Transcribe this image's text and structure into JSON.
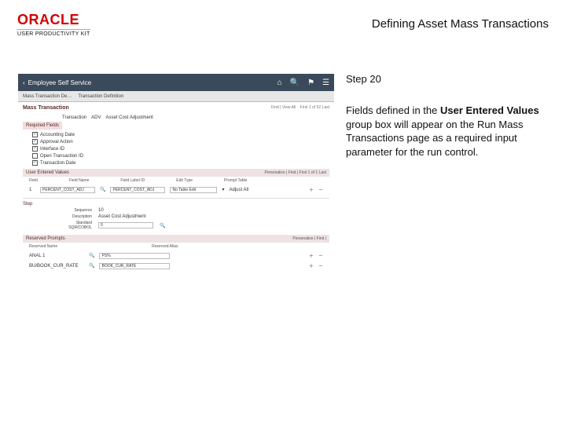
{
  "brand": {
    "oracle": "ORACLE",
    "upk": "USER PRODUCTIVITY KIT"
  },
  "page_title": "Defining Asset Mass Transactions",
  "step": {
    "label": "Step 20",
    "instruction_pre": "Fields defined in the ",
    "instruction_bold": "User Entered Values",
    "instruction_post": " group box will appear on the Run Mass Transactions page as a required input parameter for the run control."
  },
  "app": {
    "topbar_title": "Employee Self Service",
    "toolbar": {
      "item1": "Mass Transaction De…",
      "item2": "Transaction Definition"
    },
    "main_title": "Mass Transaction",
    "find_hint": "Find | View All",
    "first_meta": "First 1 of 52 Last",
    "transaction_row": {
      "label": "Transaction",
      "id": "ADV",
      "desc": "Asset Cost Adjustment"
    },
    "required_label": "Required Fields",
    "required_fields": [
      {
        "checked": true,
        "label": "Accounting Date"
      },
      {
        "checked": true,
        "label": "Approval Action"
      },
      {
        "checked": true,
        "label": "Interface ID"
      },
      {
        "checked": false,
        "label": "Open Transaction ID"
      },
      {
        "checked": true,
        "label": "Transaction Date"
      }
    ],
    "user_entered_values": {
      "title": "User Entered Values",
      "tools": "Personalize | Find | ",
      "row_count": "First 1 of 1 Last",
      "columns": [
        "Field",
        "Field Name",
        "Field Label ID",
        "Edit Type",
        "Prompt Table"
      ],
      "row": {
        "n": "1",
        "fieldName": "PERCENT_COST_ADJ",
        "labelId": "PERCENT_COST_ADJ",
        "editType": "No Table Edit",
        "prompt": "Adjust All"
      }
    },
    "step_section": "Step",
    "step_kv": [
      {
        "k": "Sequence",
        "v": "10"
      },
      {
        "k": "Description",
        "v": "Asset Cost Adjustment"
      },
      {
        "k": "Standard SQR/COBOL",
        "v": "0"
      }
    ],
    "reserved_title": "Reserved Prompts",
    "reserved_cols": [
      "Reserved Name",
      "Reserved Alias"
    ],
    "reserved_rows": [
      {
        "name": "ANAL 1",
        "alias": "PS%"
      },
      {
        "name": "BU/BOOK_CUR_RATE",
        "alias": "BOOK_CUR_RATE"
      }
    ]
  }
}
